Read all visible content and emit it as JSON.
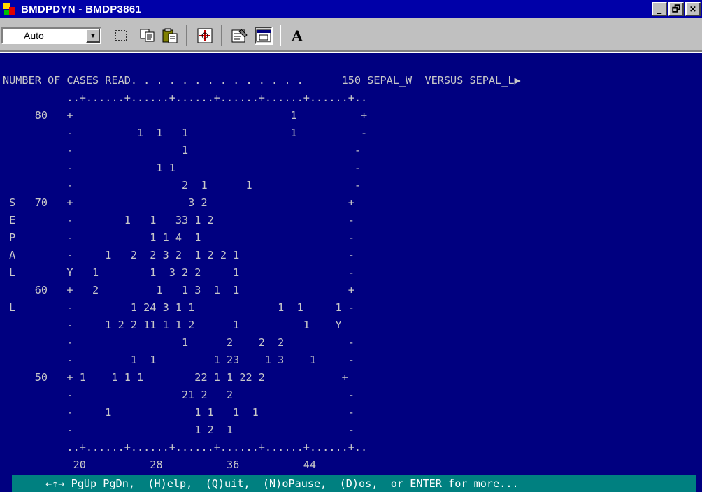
{
  "window": {
    "title": "BMDPDYN - BMDP3861",
    "icon": "bmdp-app-icon",
    "controls": {
      "minimize": "_",
      "maximize": "🗗",
      "close": "×"
    }
  },
  "toolbar": {
    "font_size_value": "Auto",
    "buttons": [
      {
        "name": "mark-button",
        "icon": "dashed-rectangle-icon"
      },
      {
        "name": "copy-button",
        "icon": "copy-icon"
      },
      {
        "name": "paste-button",
        "icon": "paste-icon"
      },
      {
        "name": "fullscreen-button",
        "icon": "crosshair-icon"
      },
      {
        "name": "properties-button",
        "icon": "properties-icon"
      },
      {
        "name": "background-button",
        "icon": "window-icon"
      },
      {
        "name": "font-button",
        "label": "A"
      }
    ]
  },
  "console": {
    "lines": [
      "NUMBER OF CASES READ. . . . . . . . . . . . . .      150 SEPAL_W  VERSUS SEPAL_L▶",
      "          ..+......+......+......+......+......+......+..",
      "     80   +                                  1          +",
      "          -          1  1   1                1          -",
      "          -                 1                          -",
      "          -             1 1                            -",
      "          -                 2  1      1                -",
      " S   70   +                  3 2                      +",
      " E        -        1   1   33 1 2                     -",
      " P        -            1 1 4  1                       -",
      " A        -     1   2  2 3 2  1 2 2 1                 -",
      " L        Y   1        1  3 2 2     1                 -",
      " _   60   +   2         1   1 3  1  1                 +",
      " L        -         1 24 3 1 1             1  1     1 -",
      "          -     1 2 2 11 1 1 2      1          1    Y",
      "          -                 1      2    2  2          -",
      "          -         1  1         1 23    1 3    1     -",
      "     50   + 1    1 1 1        22 1 1 22 2            +",
      "          -                 21 2   2                  -",
      "          -     1             1 1   1  1              -",
      "          -                   1 2  1                  -",
      "          ..+......+......+......+......+......+......+..",
      "           20          28          36          44"
    ]
  },
  "statusbar": {
    "text": "←↑→ PgUp PgDn,  (H)elp,  (Q)uit,  (N)oPause,  (D)os,  or ENTER for more..."
  },
  "colors": {
    "console_bg": "#000080",
    "console_fg": "#c8c8c8",
    "titlebar_bg": "#0000a8",
    "statusbar_bg": "#008080",
    "toolbar_bg": "#c0c0c0"
  }
}
